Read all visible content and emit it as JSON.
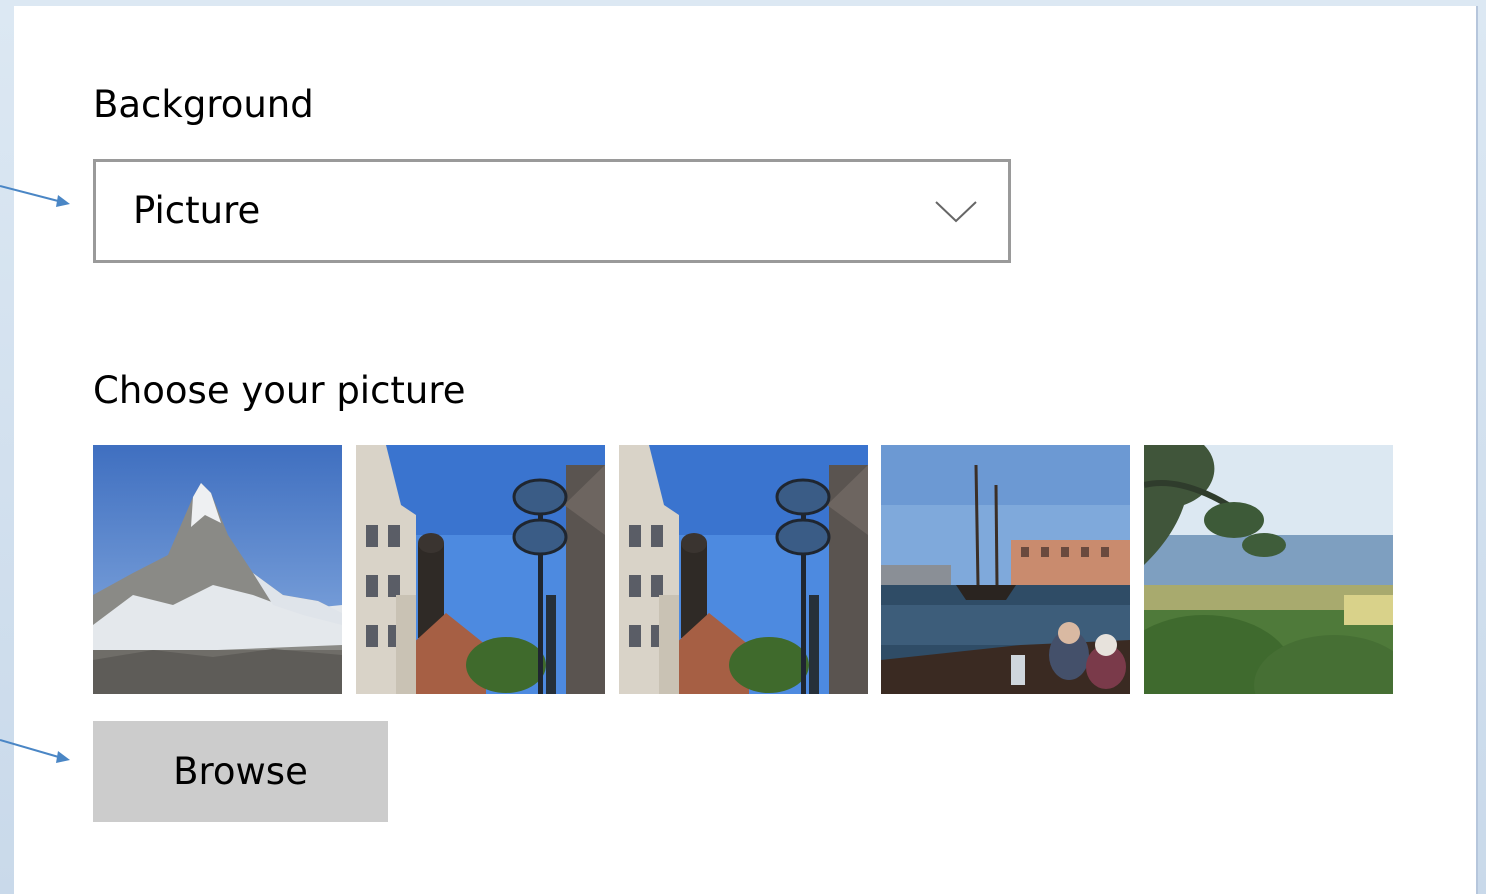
{
  "background_section": {
    "label": "Background",
    "dropdown_value": "Picture",
    "dropdown_icon": "chevron-down-icon"
  },
  "picture_section": {
    "label": "Choose your picture",
    "thumbnails": [
      {
        "subject": "mountain-peak"
      },
      {
        "subject": "city-street-church-towers"
      },
      {
        "subject": "city-street-church-towers"
      },
      {
        "subject": "harbor-sailing-ship"
      },
      {
        "subject": "coastal-countryside"
      }
    ]
  },
  "browse_button": {
    "label": "Browse"
  },
  "colors": {
    "desktop_background": "#dce8f3",
    "panel": "#ffffff",
    "dropdown_border": "#9a9a9a",
    "button_background": "#cccccc",
    "callout_arrow": "#4a86c5"
  }
}
